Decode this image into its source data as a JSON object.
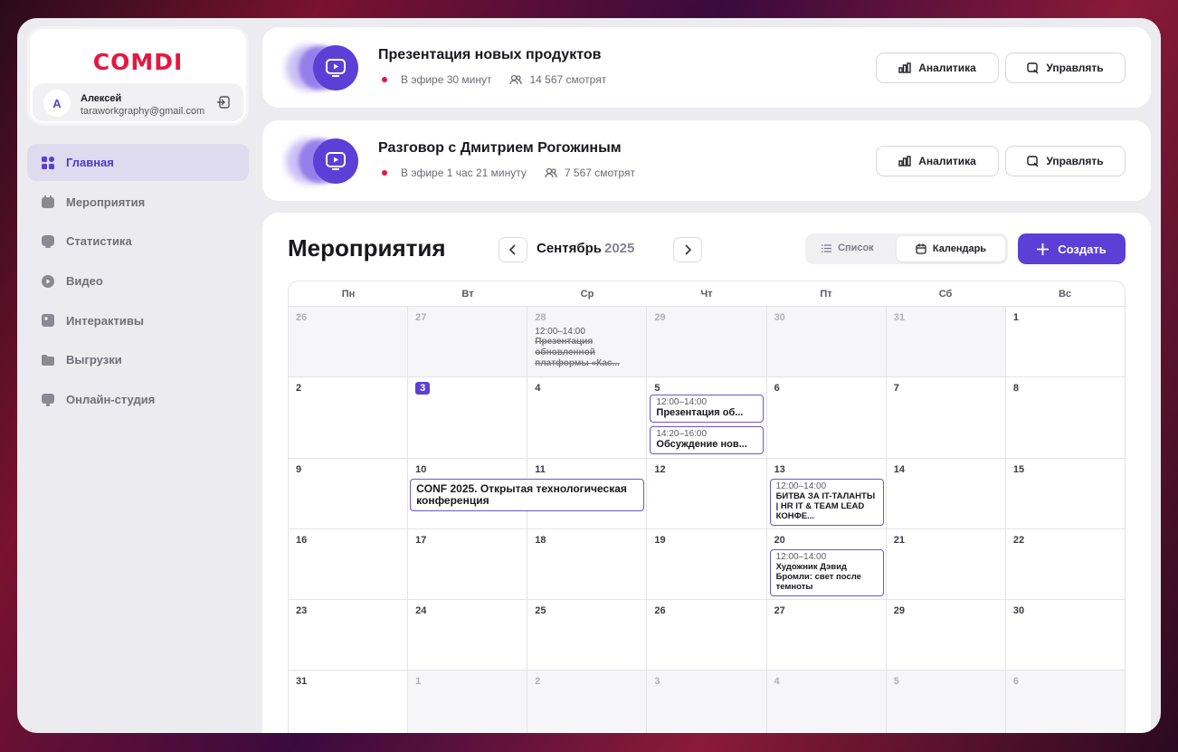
{
  "brand": {
    "logo": "COMDI"
  },
  "user": {
    "initial": "А",
    "name": "Алексей",
    "email": "taraworkgraphy@gmail.com"
  },
  "nav": [
    {
      "label": "Главная",
      "active": true
    },
    {
      "label": "Мероприятия"
    },
    {
      "label": "Статистика"
    },
    {
      "label": "Видео"
    },
    {
      "label": "Интерактивы"
    },
    {
      "label": "Выгрузки"
    },
    {
      "label": "Онлайн-студия"
    }
  ],
  "live": [
    {
      "title": "Презентация новых продуктов",
      "duration": "В эфире 30 минут",
      "viewers": "14 567 смотрят"
    },
    {
      "title": "Разговор с Дмитрием Рогожиным",
      "duration": "В эфире 1 час 21 минуту",
      "viewers": "7 567 смотрят"
    }
  ],
  "buttons": {
    "analytics": "Аналитика",
    "manage": "Управлять",
    "create": "Создать"
  },
  "events": {
    "title": "Мероприятия",
    "month": "Сентябрь",
    "year": "2025",
    "view_list": "Список",
    "view_calendar": "Календарь",
    "weekdays": [
      "Пн",
      "Вт",
      "Ср",
      "Чт",
      "Пт",
      "Сб",
      "Вс"
    ],
    "weeks": [
      [
        "26",
        "27",
        "28",
        "29",
        "30",
        "31",
        "1"
      ],
      [
        "2",
        "3",
        "4",
        "5",
        "6",
        "7",
        "8"
      ],
      [
        "9",
        "10",
        "11",
        "12",
        "13",
        "14",
        "15"
      ],
      [
        "16",
        "17",
        "18",
        "19",
        "20",
        "21",
        "22"
      ],
      [
        "23",
        "24",
        "25",
        "26",
        "27",
        "29",
        "30"
      ],
      [
        "31",
        "1",
        "2",
        "3",
        "4",
        "5",
        "6"
      ]
    ],
    "items": {
      "w0_wed": {
        "time": "12:00–14:00",
        "name": "Презентация обновленной платформы «Кас..."
      },
      "w1_thu_a": {
        "time": "12:00–14:00",
        "name": "Презентация об..."
      },
      "w1_thu_b": {
        "time": "14:20–16:00",
        "name": "Обсуждение нов..."
      },
      "w2_tue_wide": {
        "name": "CONF 2025. Открытая технологическая конференция"
      },
      "w2_fri": {
        "time": "12:00–14:00",
        "name": "БИТВА ЗА IT-ТАЛАНТЫ | HR IT & TEAM LEAD КОНФЕ..."
      },
      "w3_fri": {
        "time": "12:00–14:00",
        "name": "Художник Дэвид Бромли: свет после темноты"
      }
    }
  },
  "colors": {
    "accent": "#5b3fd6",
    "live": "#e5173f",
    "brand": "#e5173f"
  }
}
